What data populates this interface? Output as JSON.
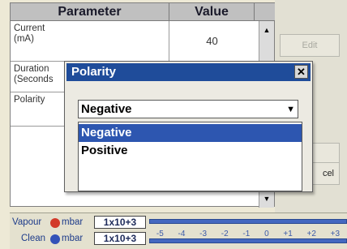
{
  "table": {
    "headers": {
      "parameter": "Parameter",
      "value": "Value"
    },
    "rows": [
      {
        "name_line1": "Current",
        "name_line2": "(mA)",
        "value": "40"
      },
      {
        "name_line1": "Duration",
        "name_line2": "(Seconds",
        "value": ""
      },
      {
        "name_line1": "Polarity",
        "name_line2": "",
        "value": ""
      }
    ]
  },
  "right_panel": {
    "edit_label": "Edit",
    "ok_label": "",
    "cancel_label": "cel"
  },
  "dialog": {
    "title": "Polarity",
    "close_glyph": "✕",
    "selected_value": "Negative",
    "options": [
      "Negative",
      "Positive"
    ],
    "highlighted_index": 0
  },
  "status": {
    "vapour": {
      "label": "Vapour",
      "unit": "mbar",
      "reading": "1x10+3"
    },
    "clean": {
      "label": "Clean",
      "unit": "mbar",
      "reading": "1x10+3"
    },
    "scale": [
      "-5",
      "-4",
      "-3",
      "-2",
      "-1",
      "0",
      "+1",
      "+2",
      "+3"
    ],
    "colors": {
      "vapour_icon": "#d23a2a",
      "clean_icon": "#3352b8",
      "bar": "#4468c0"
    }
  }
}
